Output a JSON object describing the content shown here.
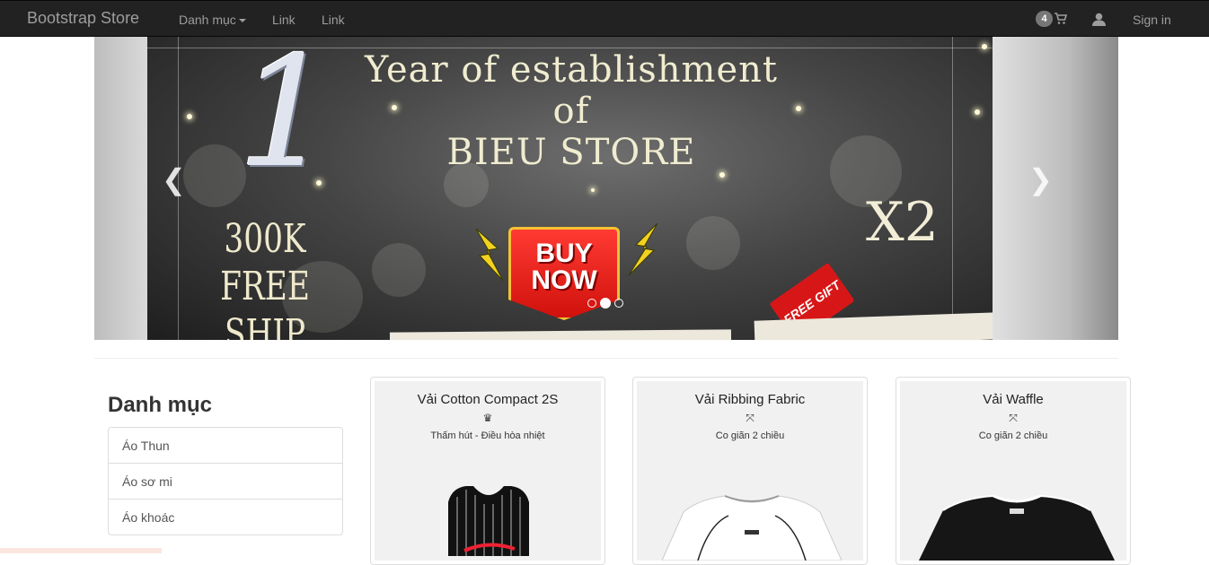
{
  "navbar": {
    "brand": "Bootstrap Store",
    "menu": [
      {
        "label": "Danh mục",
        "dropdown": true
      },
      {
        "label": "Link"
      },
      {
        "label": "Link"
      }
    ],
    "cart_count": "4",
    "sign_in": "Sign in",
    "icons": {
      "cart": "shopping-cart-icon",
      "user": "user-icon"
    }
  },
  "carousel": {
    "banner": {
      "big_number": "1",
      "title_line1": "Year of establishment of",
      "title_line2": "BIEU STORE",
      "promo_line1": "300K",
      "promo_line2": "FREE SHIP",
      "cta_line1": "BUY",
      "cta_line2": "NOW",
      "multiplier": "X2",
      "gift_tag": "FREE GIFT"
    },
    "prev_icon": "chevron-left-icon",
    "next_icon": "chevron-right-icon",
    "prev_glyph": "❮",
    "next_glyph": "❯",
    "slides": 3,
    "active_slide": 2
  },
  "sidebar": {
    "heading": "Danh mục",
    "items": [
      {
        "label": "Áo Thun"
      },
      {
        "label": "Áo sơ mi"
      },
      {
        "label": "Áo khoác"
      }
    ]
  },
  "products": [
    {
      "title": "Vải Cotton Compact 2S",
      "feature_icon": "crown-icon",
      "feature_glyph": "♛",
      "feature": "Thấm hút - Điều hòa nhiệt",
      "color": "black-striped-tank"
    },
    {
      "title": "Vải Ribbing Fabric",
      "feature_icon": "stretch-arrows-icon",
      "feature_glyph": "⤧",
      "feature": "Co giãn 2 chiều",
      "color": "white-tee"
    },
    {
      "title": "Vải Waffle",
      "feature_icon": "stretch-arrows-icon",
      "feature_glyph": "⤧",
      "feature": "Co giãn 2 chiều",
      "color": "black-tee"
    }
  ]
}
